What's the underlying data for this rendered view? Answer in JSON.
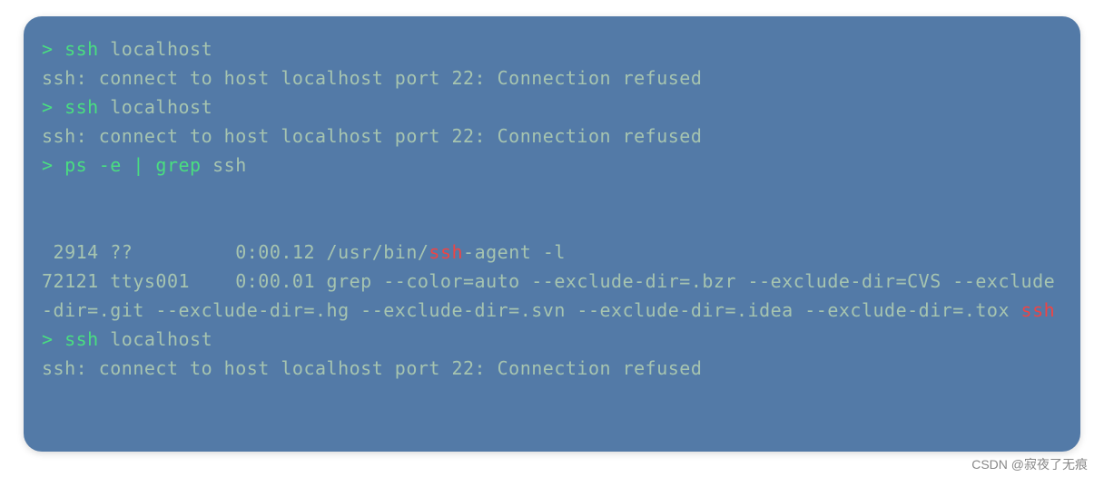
{
  "lines": {
    "l1_prompt": "> ",
    "l1_cmd": "ssh ",
    "l1_arg": "localhost",
    "l2_out": "ssh: connect to host localhost port 22: Connection refused",
    "l3_prompt": "> ",
    "l3_cmd": "ssh ",
    "l3_arg": "localhost",
    "l4_out": "ssh: connect to host localhost port 22: Connection refused",
    "l5_prompt": "> ",
    "l5_cmd": "ps -e | grep ",
    "l5_arg": "ssh",
    "blank": " ",
    "l7_a": " 2914 ??         0:00.12 /usr/bin/",
    "l7_hl": "ssh",
    "l7_b": "-agent -l",
    "l8_a": "72121 ttys001    0:00.01 grep --color=auto --exclude-dir=.bzr --exclude-dir=CVS --exclude-dir=.git --exclude-dir=.hg --exclude-dir=.svn --exclude-dir=.idea --exclude-dir=.tox ",
    "l8_hl": "ssh",
    "l9_prompt": "> ",
    "l9_cmd": "ssh ",
    "l9_arg": "localhost",
    "l10_out": "ssh: connect to host localhost port 22: Connection refused"
  },
  "watermark": "CSDN @寂夜了无痕"
}
